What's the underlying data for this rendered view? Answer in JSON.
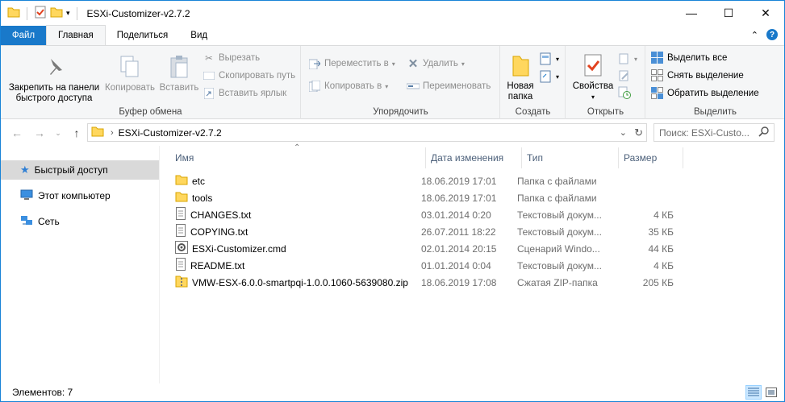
{
  "window": {
    "title": "ESXi-Customizer-v2.7.2"
  },
  "tabs": [
    "Файл",
    "Главная",
    "Поделиться",
    "Вид"
  ],
  "ribbon": {
    "clipboard": {
      "label": "Буфер обмена",
      "pin": "Закрепить на панели быстрого доступа",
      "copy": "Копировать",
      "paste": "Вставить",
      "cut": "Вырезать",
      "copy_path": "Скопировать путь",
      "paste_shortcut": "Вставить ярлык"
    },
    "organize": {
      "label": "Упорядочить",
      "move_to": "Переместить в",
      "copy_to": "Копировать в",
      "delete": "Удалить",
      "rename": "Переименовать"
    },
    "create": {
      "label": "Создать",
      "new_folder": "Новая папка"
    },
    "open": {
      "label": "Открыть",
      "properties": "Свойства"
    },
    "select": {
      "label": "Выделить",
      "select_all": "Выделить все",
      "select_none": "Снять выделение",
      "invert": "Обратить выделение"
    }
  },
  "address": {
    "path": "ESXi-Customizer-v2.7.2",
    "search_placeholder": "Поиск: ESXi-Custo..."
  },
  "nav": [
    "Быстрый доступ",
    "Этот компьютер",
    "Сеть"
  ],
  "columns": [
    "Имя",
    "Дата изменения",
    "Тип",
    "Размер"
  ],
  "files": [
    {
      "name": "etc",
      "date": "18.06.2019 17:01",
      "type": "Папка с файлами",
      "size": "",
      "icon": "folder-icon"
    },
    {
      "name": "tools",
      "date": "18.06.2019 17:01",
      "type": "Папка с файлами",
      "size": "",
      "icon": "folder-icon"
    },
    {
      "name": "CHANGES.txt",
      "date": "03.01.2014 0:20",
      "type": "Текстовый докум...",
      "size": "4 КБ",
      "icon": "text-file-icon"
    },
    {
      "name": "COPYING.txt",
      "date": "26.07.2011 18:22",
      "type": "Текстовый докум...",
      "size": "35 КБ",
      "icon": "text-file-icon"
    },
    {
      "name": "ESXi-Customizer.cmd",
      "date": "02.01.2014 20:15",
      "type": "Сценарий Windo...",
      "size": "44 КБ",
      "icon": "script-file-icon"
    },
    {
      "name": "README.txt",
      "date": "01.01.2014 0:04",
      "type": "Текстовый докум...",
      "size": "4 КБ",
      "icon": "text-file-icon"
    },
    {
      "name": "VMW-ESX-6.0.0-smartpqi-1.0.0.1060-5639080.zip",
      "date": "18.06.2019 17:08",
      "type": "Сжатая ZIP-папка",
      "size": "205 КБ",
      "icon": "zip-folder-icon"
    }
  ],
  "status": {
    "text": "Элементов: 7"
  },
  "colors": {
    "accent": "#1979ca",
    "selected_nav": "#d9d9d9",
    "folder": "#ffd75e"
  }
}
